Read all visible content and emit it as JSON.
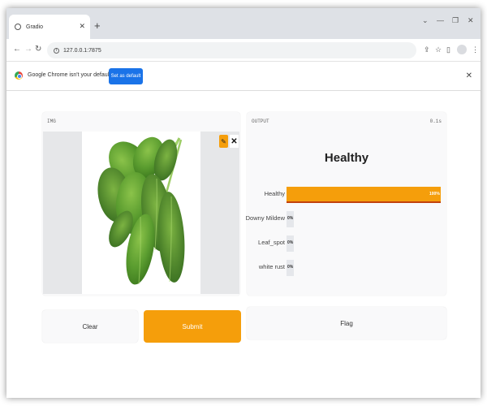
{
  "browser": {
    "tab_title": "Gradio",
    "new_tab_icon": "plus-icon",
    "url": "127.0.0.1:7875",
    "infobar_text": "Google Chrome isn't your default browser",
    "set_default_label": "Set as default"
  },
  "inputs": {
    "image_label": "IMG",
    "image_subject": "spinach leaves"
  },
  "buttons": {
    "clear": "Clear",
    "submit": "Submit",
    "flag": "Flag"
  },
  "output": {
    "label": "OUTPUT",
    "timing": "0.1s",
    "top_class": "Healthy",
    "colors": {
      "accent": "#f59e0b",
      "empty_bar": "#e5e7eb"
    },
    "confidences": [
      {
        "label": "Healthy",
        "value": 1.0,
        "pct": "100%"
      },
      {
        "label": "Downy Mildew",
        "value": 0.0,
        "pct": "0%"
      },
      {
        "label": "Leaf_spot",
        "value": 0.0,
        "pct": "0%"
      },
      {
        "label": "white rust",
        "value": 0.0,
        "pct": "0%"
      }
    ]
  }
}
